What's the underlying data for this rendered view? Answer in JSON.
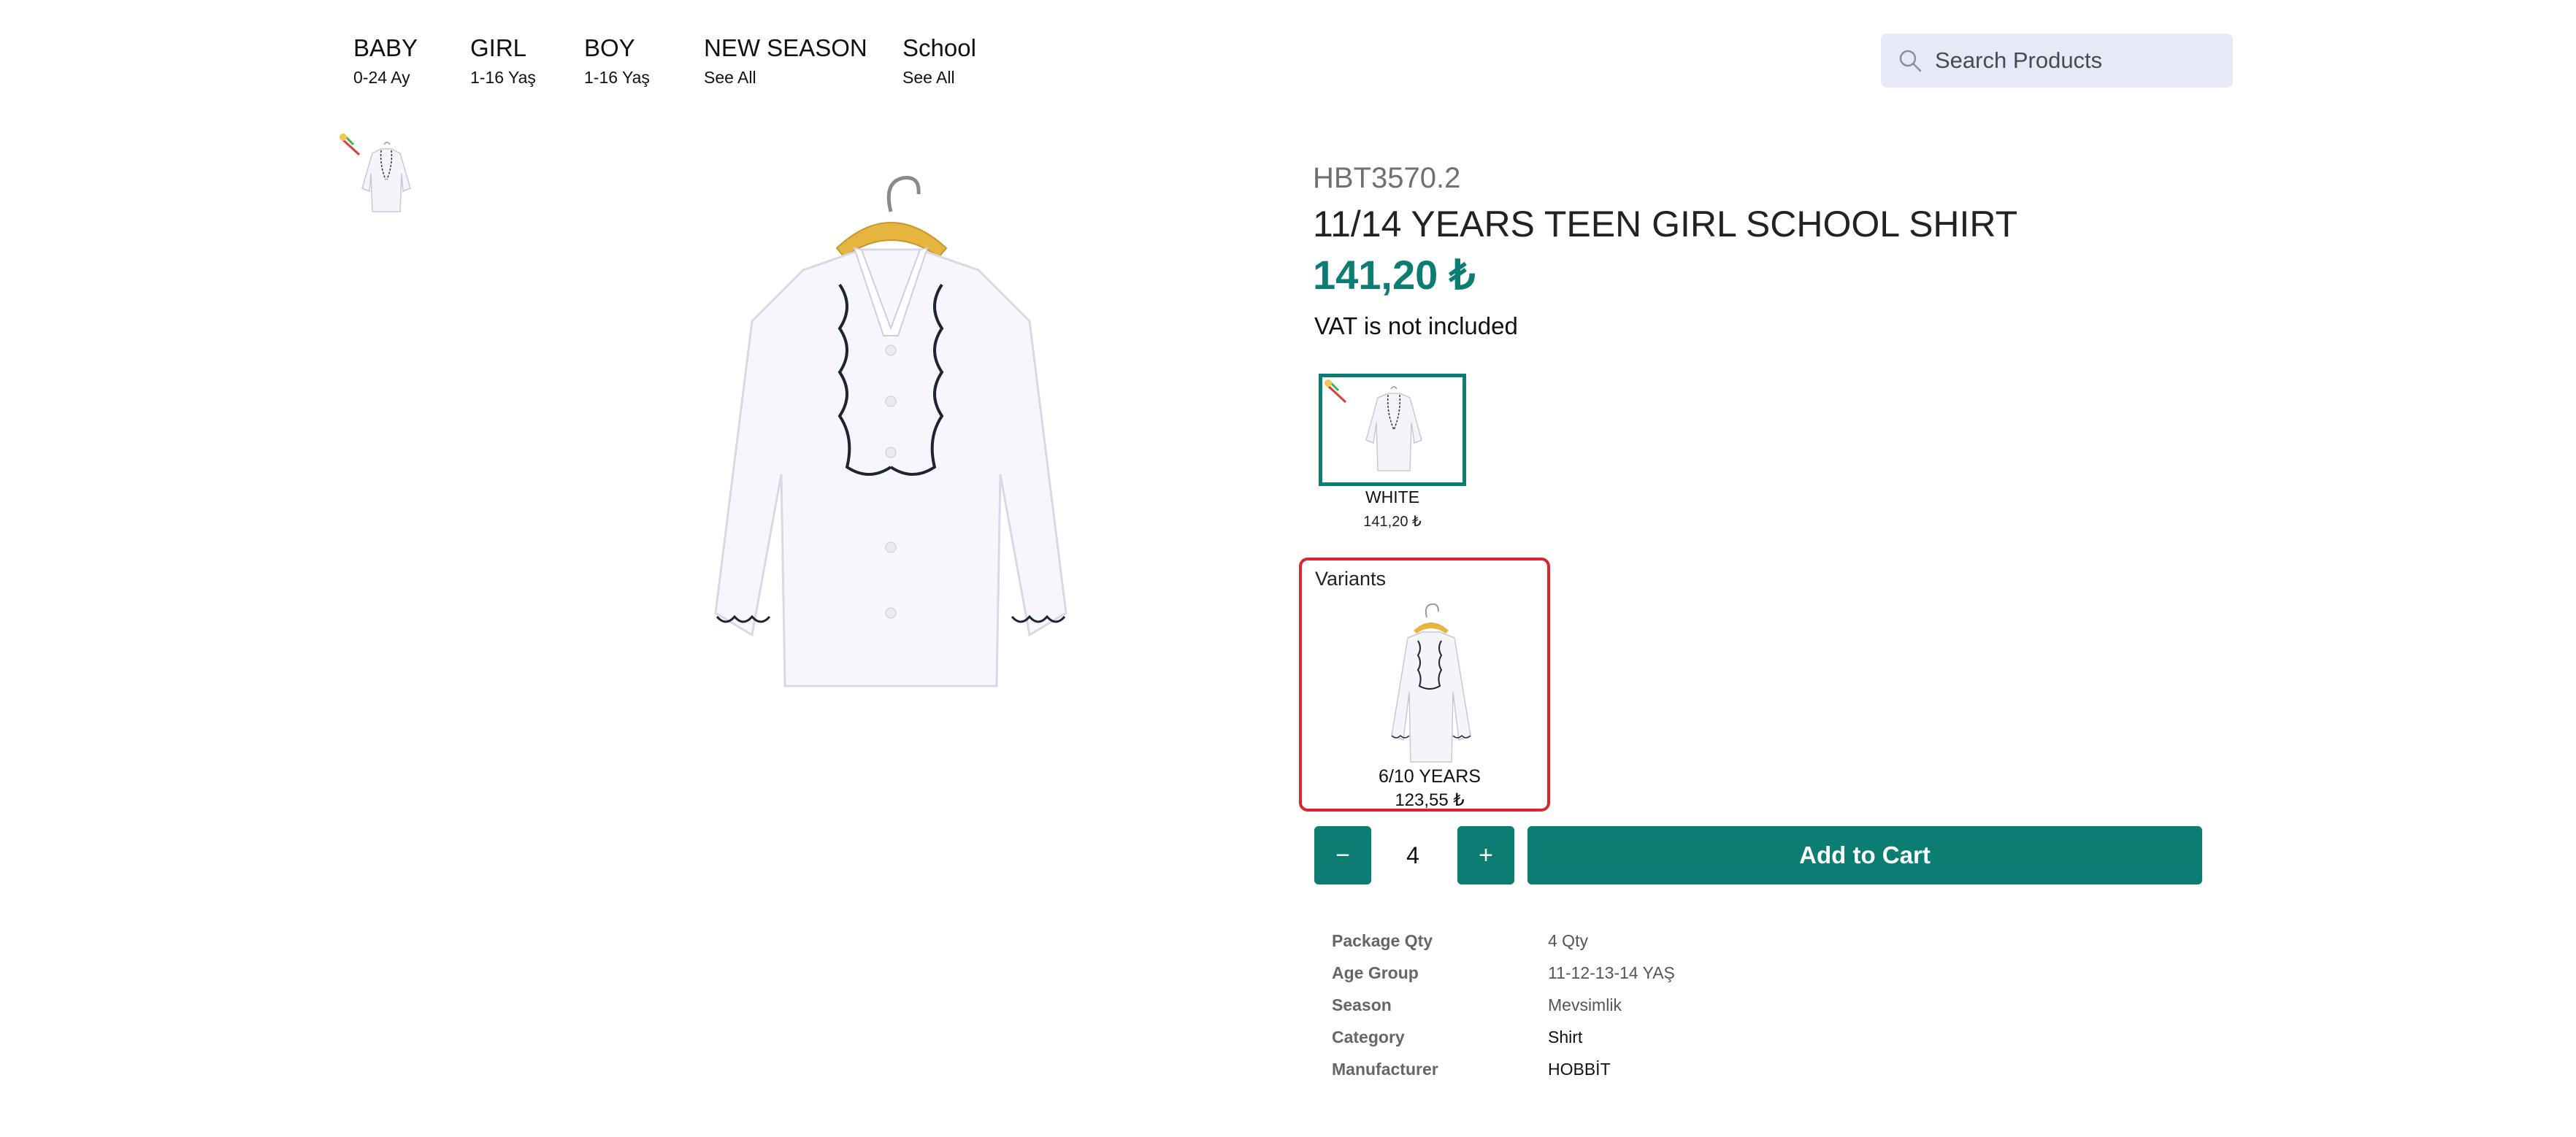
{
  "nav": {
    "items": [
      {
        "title": "BABY",
        "sub": "0-24 Ay"
      },
      {
        "title": "GIRL",
        "sub": "1-16 Yaş"
      },
      {
        "title": "BOY",
        "sub": "1-16 Yaş"
      },
      {
        "title": "NEW SEASON",
        "sub": "See All"
      },
      {
        "title": "School",
        "sub": "See All"
      }
    ]
  },
  "search": {
    "placeholder": "Search Products",
    "icon": "search-icon"
  },
  "product": {
    "sku": "HBT3570.2",
    "title": "11/14 YEARS TEEN GIRL SCHOOL SHIRT",
    "price": "141,20 ₺",
    "vat_note": "VAT is not included",
    "color_option": {
      "name": "WHITE",
      "price": "141,20 ₺"
    },
    "variants": {
      "label": "Variants",
      "items": [
        {
          "name": "6/10 YEARS",
          "price": "123,55 ₺"
        }
      ]
    },
    "quantity": {
      "value": "4",
      "minus": "−",
      "plus": "+"
    },
    "add_to_cart": "Add to Cart",
    "specs": [
      {
        "key": "Package Qty",
        "value": "4 Qty"
      },
      {
        "key": "Age Group",
        "value": "11-12-13-14 YAŞ"
      },
      {
        "key": "Season",
        "value": "Mevsimlik"
      },
      {
        "key": "Category",
        "value": "Shirt"
      },
      {
        "key": "Manufacturer",
        "value": "HOBBİT"
      }
    ]
  },
  "colors": {
    "accent": "#0b7d73",
    "variant_border": "#d9262e",
    "search_bg": "#e6e9f8"
  }
}
